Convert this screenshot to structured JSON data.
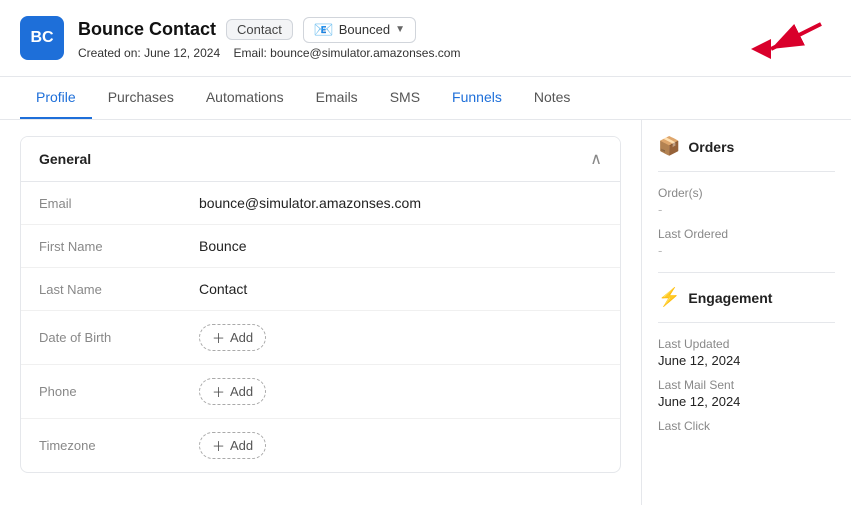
{
  "header": {
    "avatar_initials": "BC",
    "contact_name": "Bounce Contact",
    "contact_badge": "Contact",
    "bounced_label": "Bounced",
    "created_label": "Created on:",
    "created_date": "June 12, 2024",
    "email_label": "Email:",
    "email_value": "bounce@simulator.amazonses.com"
  },
  "tabs": [
    {
      "label": "Profile",
      "active": true
    },
    {
      "label": "Purchases",
      "active": false
    },
    {
      "label": "Automations",
      "active": false
    },
    {
      "label": "Emails",
      "active": false
    },
    {
      "label": "SMS",
      "active": false
    },
    {
      "label": "Funnels",
      "active": false
    },
    {
      "label": "Notes",
      "active": false
    }
  ],
  "general_section": {
    "title": "General",
    "fields": [
      {
        "label": "Email",
        "value": "bounce@simulator.amazonses.com",
        "type": "text"
      },
      {
        "label": "First Name",
        "value": "Bounce",
        "type": "text"
      },
      {
        "label": "Last Name",
        "value": "Contact",
        "type": "text"
      },
      {
        "label": "Date of Birth",
        "value": "",
        "type": "add"
      },
      {
        "label": "Phone",
        "value": "",
        "type": "add"
      },
      {
        "label": "Timezone",
        "value": "",
        "type": "add"
      }
    ],
    "add_label": "+ Add"
  },
  "right_panel": {
    "orders_title": "Orders",
    "orders_count_label": "Order(s)",
    "orders_count_value": "-",
    "last_ordered_label": "Last Ordered",
    "last_ordered_value": "-",
    "engagement_title": "Engagement",
    "last_updated_label": "Last Updated",
    "last_updated_value": "June 12, 2024",
    "last_mail_sent_label": "Last Mail Sent",
    "last_mail_sent_value": "June 12, 2024",
    "last_click_label": "Last Click"
  },
  "colors": {
    "avatar_bg": "#1e6fd9",
    "active_tab": "#1e6fd9",
    "arrow_red": "#d9002b"
  }
}
